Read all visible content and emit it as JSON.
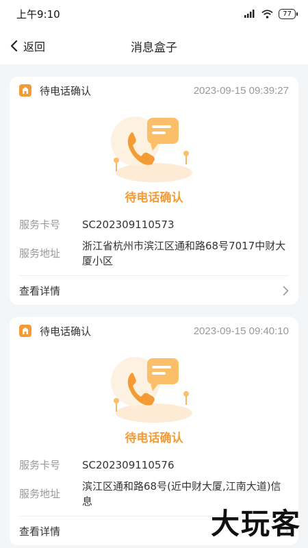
{
  "status_bar": {
    "time": "上午9:10",
    "battery": "77"
  },
  "navbar": {
    "back_label": "返回",
    "title": "消息盒子"
  },
  "cards": [
    {
      "title": "待电话确认",
      "time": "2023-09-15 09:39:27",
      "status": "待电话确认",
      "card_no_label": "服务卡号",
      "card_no": "SC202309110573",
      "address_label": "服务地址",
      "address": "浙江省杭州市滨江区通和路68号7017中财大厦小区",
      "detail_label": "查看详情"
    },
    {
      "title": "待电话确认",
      "time": "2023-09-15 09:40:10",
      "status": "待电话确认",
      "card_no_label": "服务卡号",
      "card_no": "SC202309110576",
      "address_label": "服务地址",
      "address": "滨江区通和路68号(近中财大厦,江南大道)信息",
      "detail_label": "查看详情"
    }
  ],
  "watermark": "大玩客",
  "colors": {
    "accent": "#f49b35",
    "background": "#f4f5f7"
  }
}
